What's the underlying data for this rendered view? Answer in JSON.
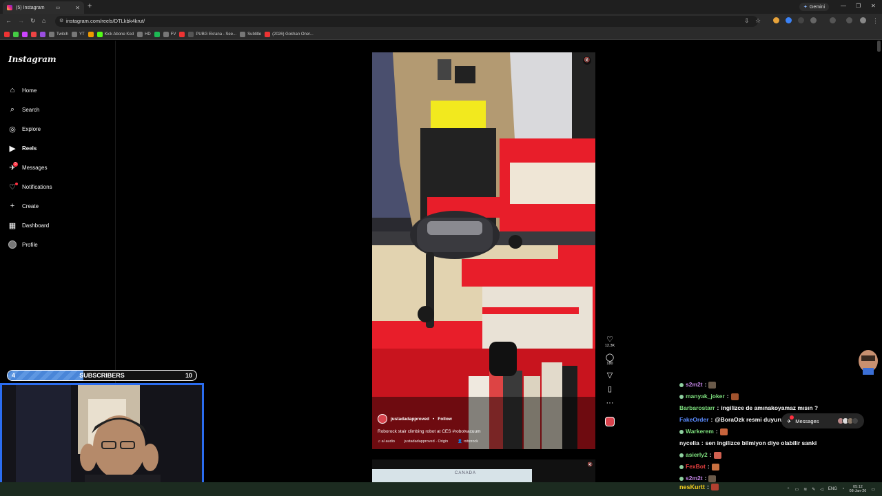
{
  "browser": {
    "tab_title": "(5) Instagram",
    "new_tab": "+",
    "gemini_label": "Gemini",
    "url": "instagram.com/reels/DTLkbk4krut/",
    "bookmarks": [
      {
        "label": "",
        "color": "#e33"
      },
      {
        "label": "",
        "color": "#4c4"
      },
      {
        "label": "",
        "color": "#c4f"
      },
      {
        "label": "",
        "color": "#e44"
      },
      {
        "label": "",
        "color": "#9a4fe0"
      },
      {
        "label": "Twitch",
        "color": "#777"
      },
      {
        "label": "YT",
        "color": "#777"
      },
      {
        "label": "",
        "color": "#e90"
      },
      {
        "label": "Kick Abone Kod",
        "color": "#53fc18"
      },
      {
        "label": "HD",
        "color": "#777"
      },
      {
        "label": "",
        "color": "#1db954"
      },
      {
        "label": "FV",
        "color": "#777"
      },
      {
        "label": "",
        "color": "#e33"
      },
      {
        "label": "PUBG Ekrana - See...",
        "color": "#555"
      },
      {
        "label": "Subtitle",
        "color": "#777"
      },
      {
        "label": "(2026) Gokhan Oner...",
        "color": "#e33"
      }
    ]
  },
  "instagram": {
    "logo": "Instagram",
    "nav": [
      {
        "id": "home",
        "label": "Home",
        "icon": "⌂"
      },
      {
        "id": "search",
        "label": "Search",
        "icon": "⌕"
      },
      {
        "id": "explore",
        "label": "Explore",
        "icon": "◎"
      },
      {
        "id": "reels",
        "label": "Reels",
        "icon": "▶"
      },
      {
        "id": "messages",
        "label": "Messages",
        "icon": "✈",
        "badge": "5"
      },
      {
        "id": "notifications",
        "label": "Notifications",
        "icon": "♡"
      },
      {
        "id": "create",
        "label": "Create",
        "icon": "+"
      },
      {
        "id": "dashboard",
        "label": "Dashboard",
        "icon": "▦"
      },
      {
        "id": "profile",
        "label": "Profile",
        "icon": ""
      }
    ],
    "reel": {
      "author": "justadadapproved",
      "separator": "•",
      "follow": "Follow",
      "caption": "Roborock stair climbing robot at CES #robotvacuum",
      "audio": "al audio",
      "audio_origin": "justadadapproved · Origin",
      "tagged": "roborock",
      "likes": "12.3K",
      "comments": "180"
    },
    "next_reel_map_label": "CANADA",
    "messages_pill": "Messages"
  },
  "stream": {
    "subs_current": "4",
    "subs_label": "SUBSCRIBERS",
    "subs_goal": "10",
    "subs_progress": 0.4,
    "chat": [
      {
        "user": "s2m2t",
        "color": "#c586e8",
        "text": "",
        "emote": "#6a5a4a"
      },
      {
        "user": "manyak_joker",
        "color": "#7ee07e",
        "text": "",
        "emote": "#a0522d"
      },
      {
        "user": "Barbarostarr",
        "color": "#7ee07e",
        "text": "ingilizce de amınakoyamaz mısın ?",
        "emote": ""
      },
      {
        "user": "FakeOrder",
        "color": "#5b8cff",
        "text": "@BoraOzk resmi duyuru geldi kulüpten",
        "emote": ""
      },
      {
        "user": "Warkerem",
        "color": "#7ee07e",
        "text": "",
        "emote": "#c8643c"
      },
      {
        "user": "nycelia",
        "color": "#f5f5f5",
        "text": "sen ingilizce bilmiyon diye olabilir sanki",
        "emote": ""
      },
      {
        "user": "asierly2",
        "color": "#7ee07e",
        "text": "",
        "emote": "#d06050"
      },
      {
        "user": "FexBot",
        "color": "#e84040",
        "text": "",
        "emote": "#c87040"
      },
      {
        "user": "s2m2t",
        "color": "#c586e8",
        "text": "",
        "emote": "#6a5a4a"
      }
    ],
    "taskbar_chat_user": "nesKurtt",
    "taskbar_chat_emote": "#b04030"
  },
  "system": {
    "language": "ENG",
    "time": "05:12",
    "date": "08-Jan-26"
  }
}
